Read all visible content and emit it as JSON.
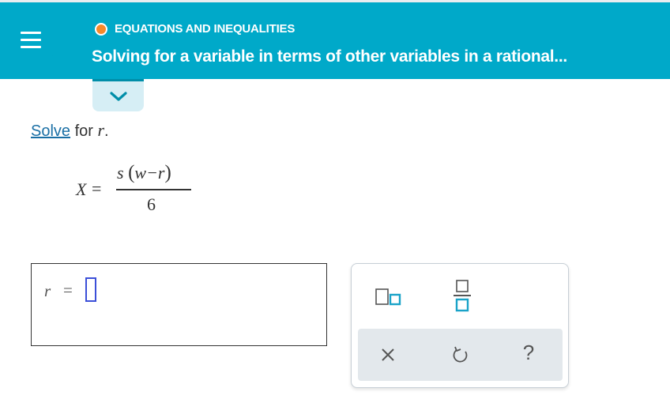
{
  "header": {
    "topic_label": "EQUATIONS AND INEQUALITIES",
    "title": "Solving for a variable in terms of other variables in a rational...",
    "menu_icon": "hamburger-menu-icon",
    "topic_dot_color": "#f5892a",
    "background_color": "#00a9c9"
  },
  "expand_tab": {
    "icon": "chevron-down-icon"
  },
  "problem": {
    "instruction_link": "Solve",
    "instruction_rest": " for ",
    "variable": "r",
    "period": "."
  },
  "equation": {
    "lhs": "X",
    "equals": "=",
    "numerator_coeff": "s",
    "numerator_open": "(",
    "numerator_inner": "w−r",
    "numerator_close": ")",
    "denominator": "6"
  },
  "answer": {
    "variable": "r",
    "equals": "=",
    "input_value": ""
  },
  "tools": {
    "superscript_icon": "exponent-template-icon",
    "fraction_icon": "fraction-template-icon",
    "clear_icon": "close-icon",
    "undo_icon": "undo-icon",
    "help_label": "?",
    "accent_color": "#1aa3c8"
  }
}
